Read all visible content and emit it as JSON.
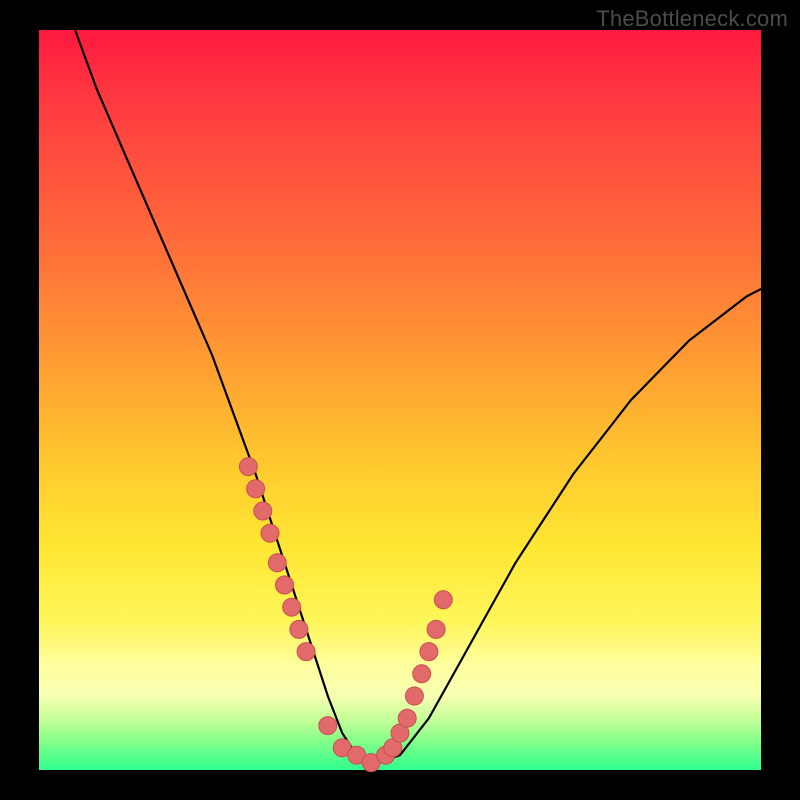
{
  "watermark": "TheBottleneck.com",
  "colors": {
    "background_frame": "#000000",
    "gradient_top": "#ff193f",
    "gradient_mid": "#ffe733",
    "gradient_bottom": "#2fff8e",
    "curve_stroke": "#000000",
    "dot_fill": "#e26a6a",
    "dot_stroke": "#c94f4f"
  },
  "chart_data": {
    "type": "line",
    "title": "",
    "xlabel": "",
    "ylabel": "",
    "xlim": [
      0,
      100
    ],
    "ylim": [
      0,
      100
    ],
    "series": [
      {
        "name": "bottleneck-curve",
        "x": [
          5,
          8,
          12,
          16,
          20,
          24,
          27,
          30,
          32,
          34,
          36,
          38,
          40,
          42,
          44,
          47,
          50,
          54,
          58,
          62,
          66,
          70,
          74,
          78,
          82,
          86,
          90,
          94,
          98,
          100
        ],
        "y": [
          100,
          92,
          83,
          74,
          65,
          56,
          48,
          40,
          34,
          28,
          22,
          16,
          10,
          5,
          2,
          1,
          2,
          7,
          14,
          21,
          28,
          34,
          40,
          45,
          50,
          54,
          58,
          61,
          64,
          65
        ]
      }
    ],
    "highlight_points": {
      "name": "marked-points",
      "x": [
        29,
        30,
        31,
        32,
        33,
        34,
        35,
        36,
        37,
        40,
        42,
        44,
        46,
        48,
        49,
        50,
        51,
        52,
        53,
        54,
        55,
        56
      ],
      "y": [
        41,
        38,
        35,
        32,
        28,
        25,
        22,
        19,
        16,
        6,
        3,
        2,
        1,
        2,
        3,
        5,
        7,
        10,
        13,
        16,
        19,
        23
      ]
    }
  }
}
